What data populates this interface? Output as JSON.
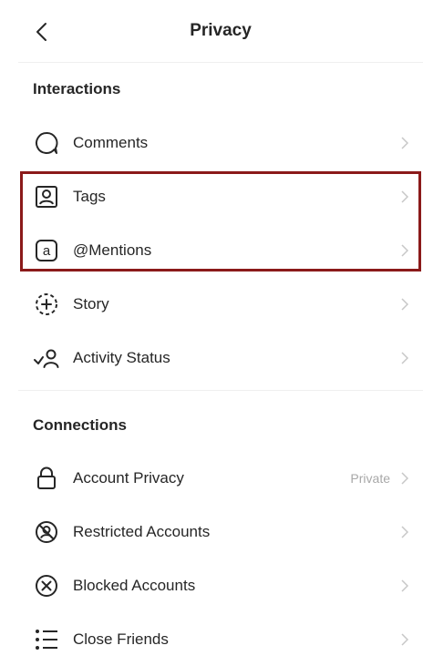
{
  "header": {
    "title": "Privacy",
    "back_icon": "chevron-left-icon"
  },
  "sections": {
    "interactions": {
      "title": "Interactions",
      "items": [
        {
          "label": "Comments",
          "icon": "comment-bubble-icon"
        },
        {
          "label": "Tags",
          "icon": "tag-person-icon"
        },
        {
          "label": "@Mentions",
          "icon": "at-sign-icon"
        },
        {
          "label": "Story",
          "icon": "story-plus-icon"
        },
        {
          "label": "Activity Status",
          "icon": "activity-status-icon"
        }
      ]
    },
    "connections": {
      "title": "Connections",
      "items": [
        {
          "label": "Account Privacy",
          "value": "Private",
          "icon": "lock-icon"
        },
        {
          "label": "Restricted Accounts",
          "icon": "restricted-icon"
        },
        {
          "label": "Blocked Accounts",
          "icon": "blocked-icon"
        },
        {
          "label": "Close Friends",
          "icon": "close-friends-list-icon"
        }
      ]
    }
  },
  "colors": {
    "highlight": "#8b1a1a",
    "text": "#262626",
    "muted": "#a8a8a8",
    "divider": "#efefef"
  }
}
